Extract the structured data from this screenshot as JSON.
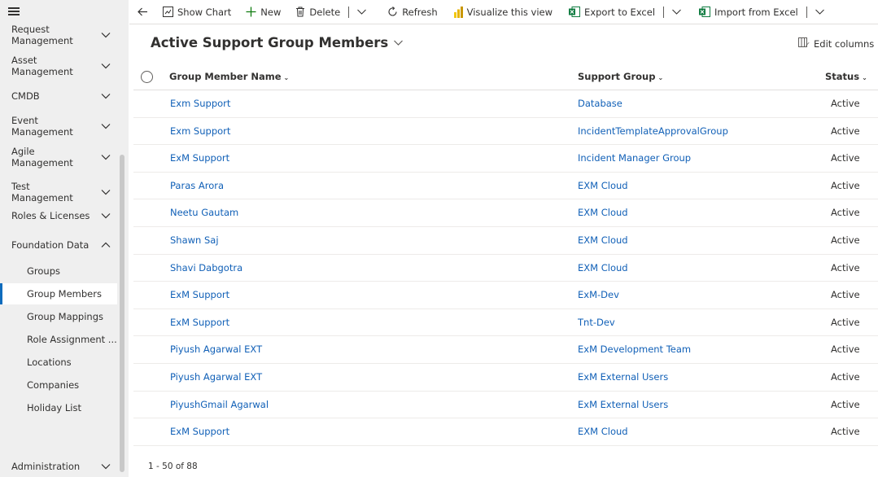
{
  "sidebar": {
    "groups": [
      {
        "label": "Request Management"
      },
      {
        "label": "Asset Management"
      },
      {
        "label": "CMDB"
      },
      {
        "label": "Event Management"
      },
      {
        "label": "Agile Management"
      },
      {
        "label": "Test Management"
      },
      {
        "label": "Roles & Licenses"
      },
      {
        "label": "Foundation Data"
      },
      {
        "label": "Administration"
      }
    ],
    "sub_items": [
      {
        "label": "Groups"
      },
      {
        "label": "Group Members"
      },
      {
        "label": "Group Mappings"
      },
      {
        "label": "Role Assignment ..."
      },
      {
        "label": "Locations"
      },
      {
        "label": "Companies"
      },
      {
        "label": "Holiday List"
      }
    ]
  },
  "toolbar": {
    "show_chart": "Show Chart",
    "new": "New",
    "delete": "Delete",
    "refresh": "Refresh",
    "visualize": "Visualize this view",
    "export_excel": "Export to Excel",
    "import_excel": "Import from Excel"
  },
  "view": {
    "title": "Active Support Group Members",
    "edit_columns": "Edit columns"
  },
  "grid": {
    "columns": {
      "member": "Group Member Name",
      "group": "Support Group",
      "status": "Status"
    },
    "rows": [
      {
        "member": "Exm Support",
        "group": "Database",
        "status": "Active"
      },
      {
        "member": "Exm Support",
        "group": "IncidentTemplateApprovalGroup",
        "status": "Active"
      },
      {
        "member": "ExM Support",
        "group": "Incident Manager Group",
        "status": "Active"
      },
      {
        "member": "Paras Arora",
        "group": "EXM Cloud",
        "status": "Active"
      },
      {
        "member": "Neetu Gautam",
        "group": "EXM Cloud",
        "status": "Active"
      },
      {
        "member": "Shawn Saj",
        "group": "EXM Cloud",
        "status": "Active"
      },
      {
        "member": "Shavi Dabgotra",
        "group": "EXM Cloud",
        "status": "Active"
      },
      {
        "member": "ExM Support",
        "group": "ExM-Dev",
        "status": "Active"
      },
      {
        "member": "ExM Support",
        "group": "Tnt-Dev",
        "status": "Active"
      },
      {
        "member": "Piyush Agarwal EXT",
        "group": "ExM Development Team",
        "status": "Active"
      },
      {
        "member": "Piyush Agarwal EXT",
        "group": "ExM External Users",
        "status": "Active"
      },
      {
        "member": "PiyushGmail Agarwal",
        "group": "ExM External Users",
        "status": "Active"
      },
      {
        "member": "ExM Support",
        "group": "EXM Cloud",
        "status": "Active"
      }
    ],
    "footer": "1 - 50 of 88"
  },
  "colors": {
    "link": "#1160b7",
    "accent": "#0f6cbd",
    "excel_green": "#107c41",
    "powerbi_yellow": "#f2c811",
    "new_green": "#107c10"
  }
}
